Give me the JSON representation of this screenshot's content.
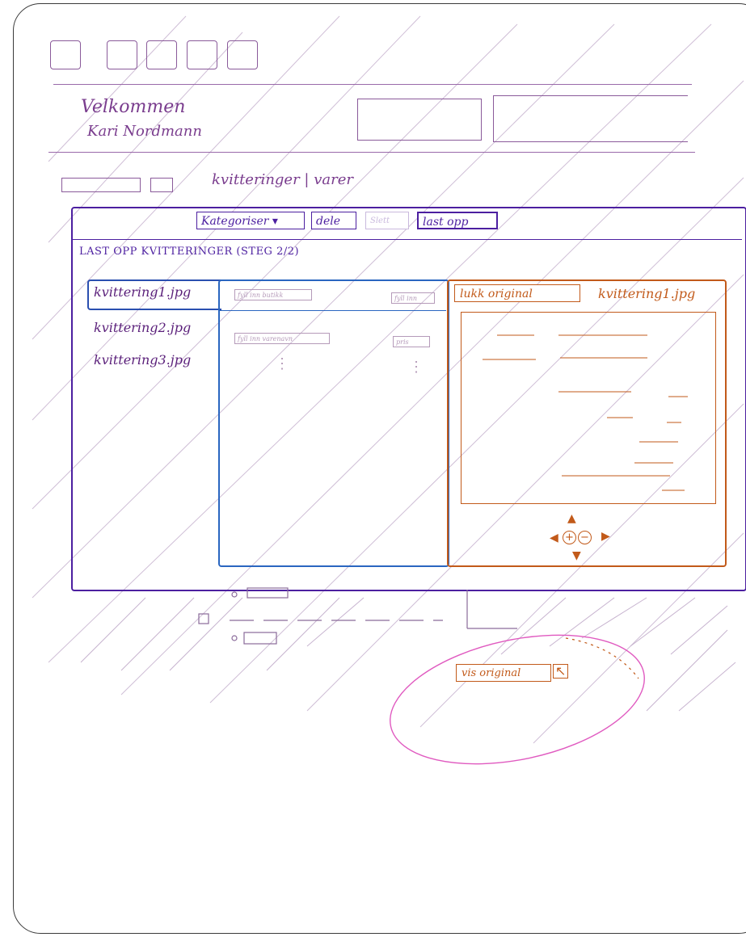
{
  "header": {
    "welcome_line1": "Velkommen",
    "welcome_line2": "Kari Nordmann"
  },
  "nav": {
    "tabs_label": "kvitteringer | varer"
  },
  "toolbar": {
    "categorize_label": "Kategoriser ▾",
    "share_label": "dele",
    "delete_label": "Slett",
    "upload_label": "last opp"
  },
  "main": {
    "step_title": "LAST OPP KVITTERINGER (STEG 2/2)",
    "files": [
      "kvittering1.jpg",
      "kvittering2.jpg",
      "kvittering3.jpg"
    ],
    "fields": {
      "fill_store": "fyll inn butikk",
      "fill_action": "fyll inn",
      "fill_product": "fyll inn varenavn",
      "fill_price": "pris",
      "ellipsis": "⋮"
    },
    "preview": {
      "close_original_label": "lukk original",
      "filename": "kvittering1.jpg"
    },
    "controls": {
      "up": "▲",
      "down": "▼",
      "left": "◀",
      "right": "▶",
      "zoom_in": "+",
      "zoom_out": "−"
    }
  },
  "popup": {
    "show_original_label": "vis original",
    "cursor": "↖"
  },
  "colors": {
    "ink_purple": "#7a3d8e",
    "ink_violet": "#4c1fa0",
    "ink_blue": "#2a66c0",
    "ink_orange": "#c25a1a",
    "ink_pink": "#e05ac0"
  }
}
